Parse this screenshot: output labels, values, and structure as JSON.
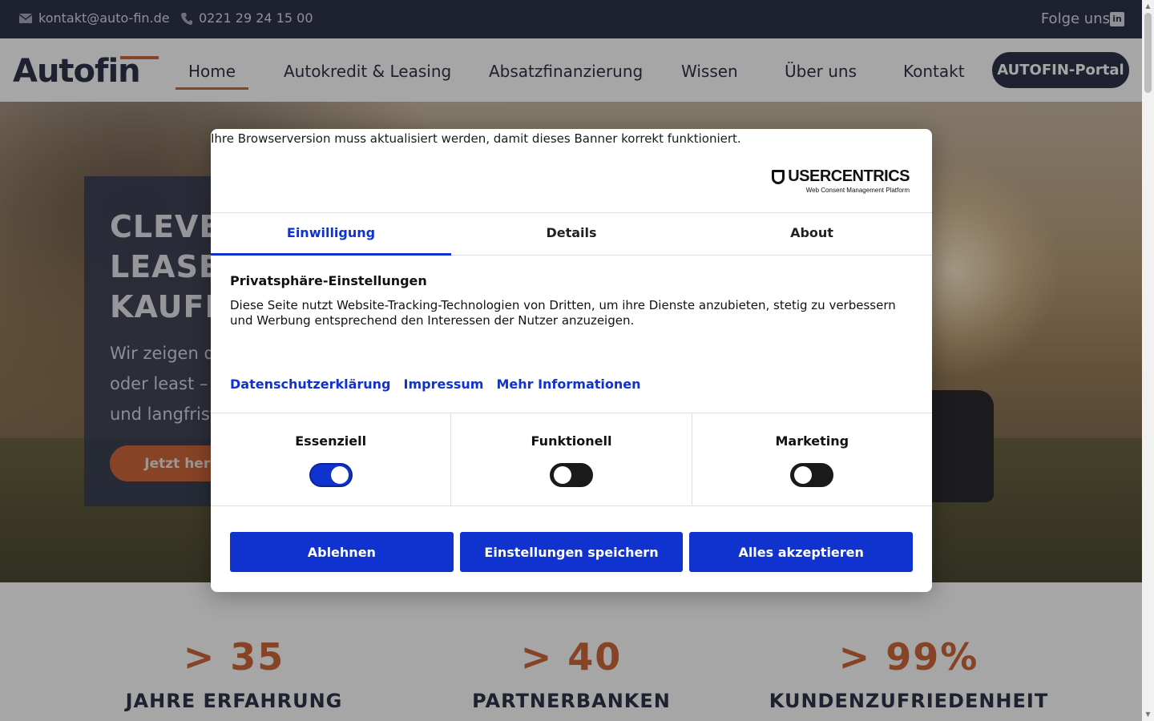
{
  "topbar": {
    "email": "kontakt@auto-fin.de",
    "phone": "0221 29 24 15 00",
    "follow": "Folge uns",
    "linkedin_glyph": "in",
    "icons": {
      "email": "mail-icon",
      "phone": "phone-icon",
      "social": "linkedin-icon"
    }
  },
  "nav": {
    "logo": "Autofin",
    "items": [
      {
        "label": "Home",
        "active": true
      },
      {
        "label": "Autokredit & Leasing"
      },
      {
        "label": "Absatzfinanzierung"
      },
      {
        "label": "Wissen"
      },
      {
        "label": "Über uns"
      },
      {
        "label": "Kontakt"
      }
    ],
    "portal": "AUTOFIN-Portal"
  },
  "hero": {
    "title_lines": [
      "CLEVER",
      "LEASEN",
      "KAUFEN"
    ],
    "text_lines": [
      "Wir zeigen d",
      "oder least –",
      "und langfrist"
    ],
    "cta": "Jetzt hera"
  },
  "stats": [
    {
      "value": "> 35",
      "label": "JAHRE ERFAHRUNG"
    },
    {
      "value": "> 40",
      "label": "PARTNERBANKEN"
    },
    {
      "value": "> 99%",
      "label": "KUNDENZUFRIEDENHEIT"
    }
  ],
  "consent": {
    "browser_notice": "Ihre Browserversion muss aktualisiert werden, damit dieses Banner korrekt funktioniert.",
    "brand": {
      "name": "USERCENTRICS",
      "sub": "Web Consent Management Platform"
    },
    "tabs": [
      {
        "label": "Einwilligung",
        "active": true
      },
      {
        "label": "Details"
      },
      {
        "label": "About"
      }
    ],
    "heading": "Privatsphäre-Einstellungen",
    "body": "Diese Seite nutzt Website-Tracking-Technologien von Dritten, um ihre Dienste anzubieten, stetig zu verbessern und Werbung entsprechend den Interessen der Nutzer anzuzeigen.",
    "links": [
      "Datenschutzerklärung",
      "Impressum",
      "Mehr Informationen"
    ],
    "categories": [
      {
        "label": "Essenziell",
        "enabled": true
      },
      {
        "label": "Funktionell",
        "enabled": false
      },
      {
        "label": "Marketing",
        "enabled": false
      }
    ],
    "buttons": {
      "deny": "Ablehnen",
      "save": "Einstellungen speichern",
      "accept": "Alles akzeptieren"
    },
    "colors": {
      "accent": "#1032cf",
      "brand_orange": "#d0673b",
      "navy": "#2f3349"
    }
  }
}
